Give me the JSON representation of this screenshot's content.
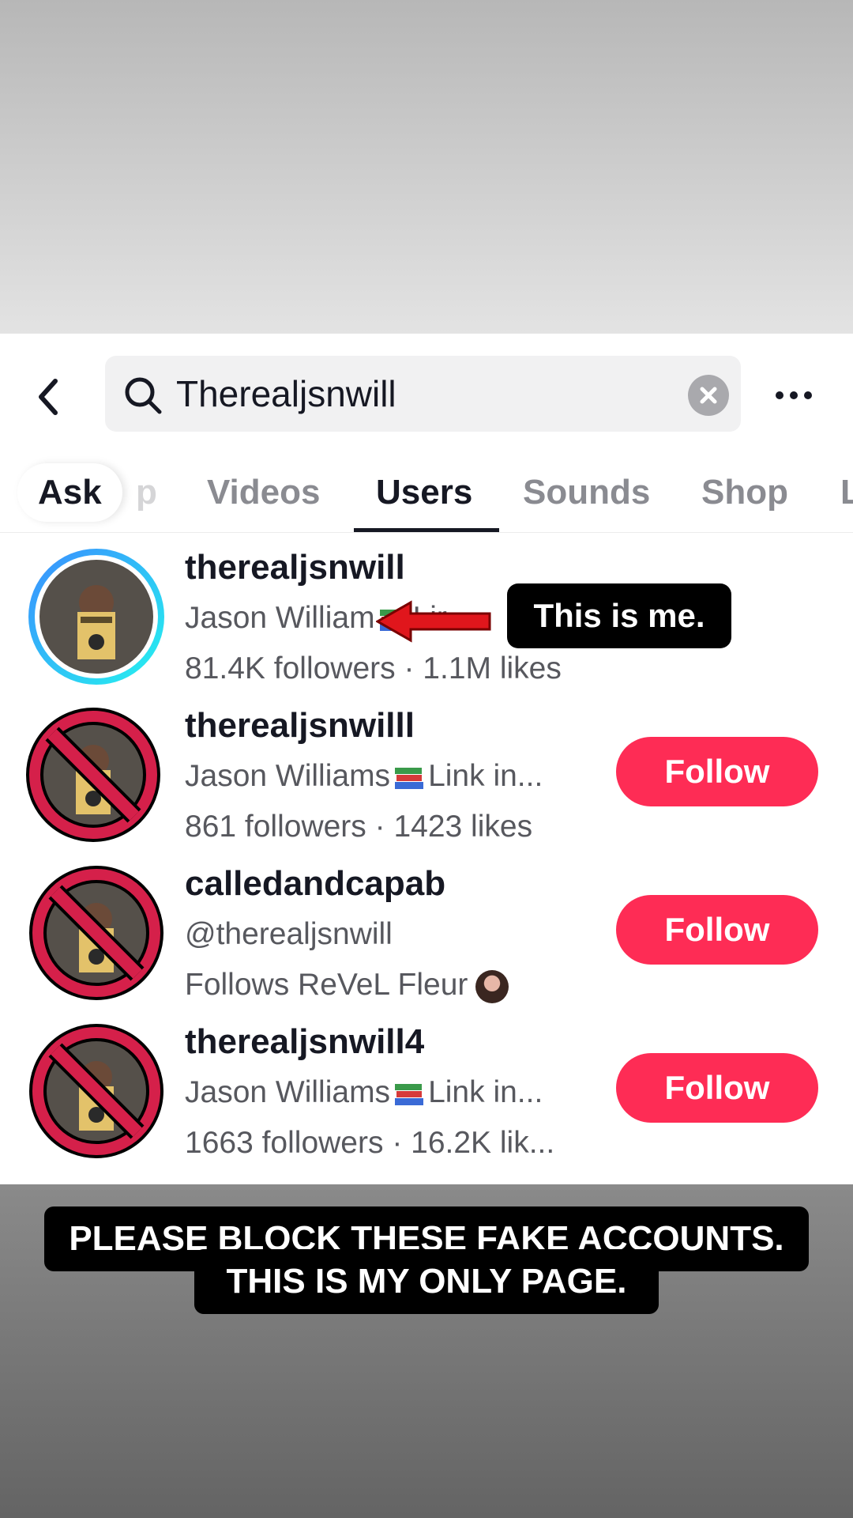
{
  "search": {
    "query": "Therealjsnwill"
  },
  "tabs": {
    "ask": "Ask",
    "hidden_partial": "p",
    "items": [
      "Videos",
      "Users",
      "Sounds",
      "Shop",
      "L"
    ],
    "active": "Users"
  },
  "users": [
    {
      "username": "therealjsnwill",
      "subtitle_prefix": "Jason William",
      "subtitle_suffix": "Lir",
      "stats": "81.4K followers · 1.1M likes",
      "status": "real"
    },
    {
      "username": "therealjsnwilll",
      "subtitle_prefix": "Jason Williams",
      "subtitle_suffix": "Link in...",
      "stats": "861 followers · 1423 likes",
      "follow_label": "Follow",
      "status": "fake"
    },
    {
      "username": "calledandcapab",
      "subtitle": "@therealjsnwill",
      "stats": "Follows ReVeL Fleur",
      "follow_label": "Follow",
      "status": "fake"
    },
    {
      "username": "therealjsnwill4",
      "subtitle_prefix": "Jason Williams",
      "subtitle_suffix": "Link in...",
      "stats": "1663 followers · 16.2K lik...",
      "follow_label": "Follow",
      "status": "fake"
    }
  ],
  "annotations": {
    "note": "This is me.",
    "caption_line_1": "PLEASE BLOCK THESE FAKE ACCOUNTS.",
    "caption_line_2": "THIS IS MY ONLY PAGE."
  },
  "colors": {
    "follow_bg": "#fe2c55",
    "ring_gradient": [
      "#25f4ee",
      "#3b8cff"
    ],
    "prohibit_red": "#d5204a",
    "arrow_red": "#e0161c"
  },
  "icons": [
    "back-arrow-icon",
    "search-icon",
    "clear-icon",
    "more-icon",
    "books-emoji-icon",
    "prohibited-icon"
  ]
}
